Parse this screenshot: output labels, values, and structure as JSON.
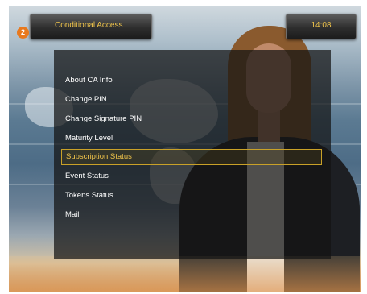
{
  "header": {
    "title": "Conditional Access",
    "step_number": "2",
    "clock": "14:08"
  },
  "menu": {
    "selected_index": 4,
    "items": [
      {
        "label": "About CA Info"
      },
      {
        "label": "Change PIN"
      },
      {
        "label": "Change Signature PIN"
      },
      {
        "label": "Maturity Level"
      },
      {
        "label": "Subscription Status"
      },
      {
        "label": "Event Status"
      },
      {
        "label": "Tokens Status"
      },
      {
        "label": "Mail"
      }
    ]
  },
  "colors": {
    "accent_text": "#f0c44a",
    "badge": "#e8791e",
    "selection_border": "#c9a128"
  }
}
